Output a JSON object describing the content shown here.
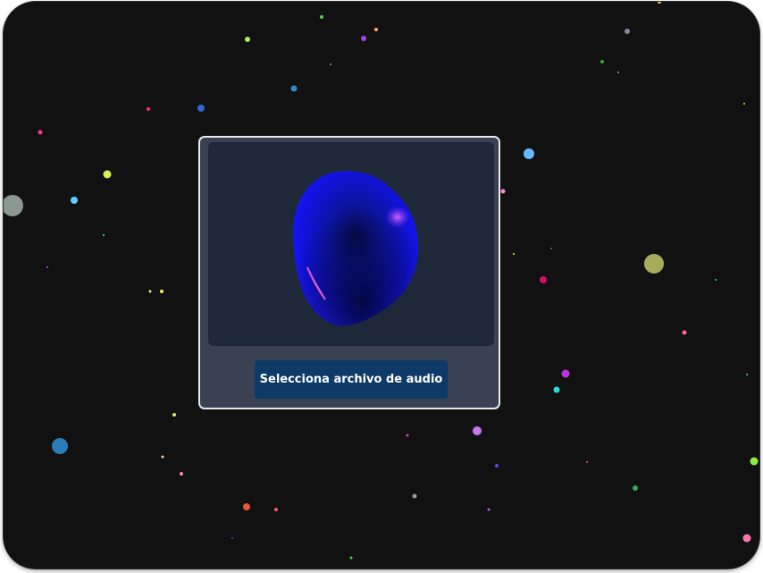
{
  "player": {
    "upload_button_label": "Selecciona archivo de audio"
  },
  "colors": {
    "background": "#111111",
    "panel": "#394152",
    "viewport": "#1f2838",
    "button": "#0d3a66",
    "blob_core": "#0a0f6e",
    "blob_edge": "#1a1aff",
    "highlight": "#ff66cc"
  },
  "icons": {
    "visualizer": "audio-reactive-blob"
  }
}
